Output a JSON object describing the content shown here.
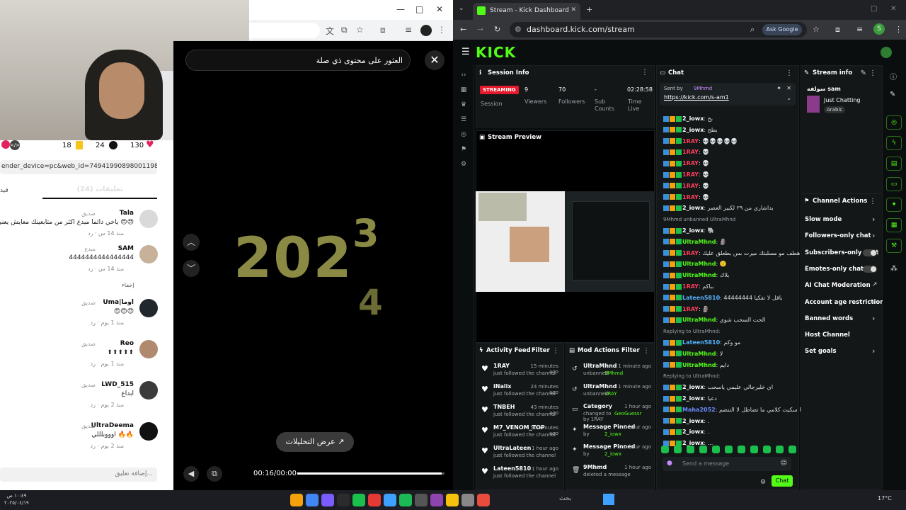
{
  "left_browser": {
    "search_text": "العثور على محتوى ذي صلة",
    "window_controls": {
      "minimize": "—",
      "maximize": "□",
      "close": "✕"
    }
  },
  "tiktok": {
    "stats": {
      "likes": "130",
      "comments": "24",
      "saves": "18"
    },
    "url_fragment": "ender_device=pc&web_id=7494199089800119863",
    "comments_tab": "تعليقات (24)",
    "other_tab": "قيد",
    "hide_label": "إخفاء",
    "input_placeholder": "إضافة تعليق...",
    "comments": [
      {
        "name": "Tala",
        "tag": "صديق",
        "text": "ياخي دائما مبدع اكثر من متابعينك معايش يعني 😍😍",
        "meta": "منذ 14 س · رد"
      },
      {
        "name": "SAM",
        "tag": "مبدع",
        "text": "4444444444444444",
        "meta": "منذ 14 س · رد"
      },
      {
        "name": "Uma|اوما",
        "tag": "صديق",
        "text": "😍😍😍",
        "meta": "منذ 1 يوم · رد"
      },
      {
        "name": "Reo",
        "tag": "صديق",
        "text": "⬆⬆⬆⬆⬆",
        "meta": "منذ 1 يوم · رد"
      },
      {
        "name": "LWD_515",
        "tag": "صديق",
        "text": "ابداع",
        "meta": "منذ 2 يوم · رد"
      },
      {
        "name": "UltraDeema",
        "tag": "صديق",
        "text": "اوووبلللي 🔥🔥",
        "meta": "منذ 2 يوم · رد"
      }
    ]
  },
  "video": {
    "year_text": "202",
    "digit_top": "3",
    "digit_bottom": "4",
    "analytics_button": "عرض التحليلات",
    "time": "00:16/00:00",
    "progress_fraction": 0.98
  },
  "right_browser": {
    "tab_title": "Stream - Kick Dashboard",
    "url": "dashboard.kick.com/stream",
    "ask_google": "Ask Google"
  },
  "kick": {
    "logo": "KICK",
    "session_info": {
      "title": "Session Info",
      "status": "STREAMING",
      "status_label": "Session",
      "viewers": "9",
      "viewers_label": "Viewers",
      "followers": "70",
      "followers_label": "Followers",
      "subs": "-",
      "subs_label": "Sub Counts",
      "time": "02:28:58",
      "time_label": "Time Live"
    },
    "stream_preview": {
      "title": "Stream Preview"
    },
    "activity_feed": {
      "title": "Activity Feed",
      "filter": "Filter",
      "items": [
        {
          "name": "1RAY",
          "sub": "just followed the channel",
          "time": "15 minutes ago"
        },
        {
          "name": "iNalix",
          "sub": "just followed the channel",
          "time": "24 minutes ago"
        },
        {
          "name": "TNBEH",
          "sub": "just followed the channel",
          "time": "43 minutes ago"
        },
        {
          "name": "M7_VENOM_TOP",
          "sub": "just followed the channel",
          "time": "55 minutes ago"
        },
        {
          "name": "UltraLateen",
          "sub": "just followed the channel",
          "time": "1 hour ago"
        },
        {
          "name": "Lateen5810",
          "sub": "just followed the channel",
          "time": "1 hour ago"
        }
      ]
    },
    "mod_actions": {
      "title": "Mod Actions",
      "filter": "Filter",
      "items": [
        {
          "name": "UltraMhnd",
          "line1": "unbanned",
          "target": "9Mhmd",
          "time": "1 minute ago"
        },
        {
          "name": "UltraMhnd",
          "line1": "unbanned",
          "target": "1RAY",
          "time": "1 minute ago"
        },
        {
          "name": "Category",
          "line1": "changed to",
          "target": "GeoGuessr",
          "line2": "by 1RAY",
          "time": "1 hour ago"
        },
        {
          "name": "Message Pinned",
          "line1": "by",
          "target": "2_iowx",
          "time": "1 hour ago"
        },
        {
          "name": "Message Pinned",
          "line1": "by",
          "target": "2_iowx",
          "time": "1 hour ago"
        },
        {
          "name": "9Mhmd",
          "line1": "deleted a message",
          "target": "",
          "time": "1 hour ago"
        }
      ]
    },
    "chat": {
      "title": "Chat",
      "pinned_by": "Sent by",
      "pinned_user": "9Mhmd",
      "pinned_link": "https://kick.com/s-am1",
      "messages": [
        {
          "user": "2_iowx",
          "text": "بح",
          "color": "#ffffff"
        },
        {
          "user": "2_iowx",
          "text": "بطح",
          "color": "#ffffff"
        },
        {
          "user": "1RAY",
          "text": "💀💀💀💀💀",
          "color": "#ff3b5c"
        },
        {
          "user": "1RAY",
          "text": "💀",
          "color": "#ff3b5c"
        },
        {
          "user": "1RAY",
          "text": "💀",
          "color": "#ff3b5c"
        },
        {
          "user": "1RAY",
          "text": "💀",
          "color": "#ff3b5c"
        },
        {
          "user": "1RAY",
          "text": "💀",
          "color": "#ff3b5c"
        },
        {
          "user": "1RAY",
          "text": "💀",
          "color": "#ff3b5c"
        },
        {
          "user": "2_iowx",
          "text": "بداشاري من ٢٩ لكبير العصر",
          "color": "#ffffff"
        },
        {
          "user": "system",
          "text": "9Mhmd unbanned UltraMhnd",
          "color": "#9aa0a6"
        },
        {
          "user": "2_iowx",
          "text": "🐘",
          "color": "#ffffff"
        },
        {
          "user": "UltraMhnd",
          "text": "🗿",
          "color": "#53fc18"
        },
        {
          "user": "1RAY",
          "text": "مهند ياهطف مو مسلبتك ميرت بس بطعلق عليك",
          "color": "#ff3b5c"
        },
        {
          "user": "UltraMhnd",
          "text": "🙂",
          "color": "#53fc18"
        },
        {
          "user": "UltraMhnd",
          "text": "بلاك",
          "color": "#53fc18"
        },
        {
          "user": "1RAY",
          "text": "بباكم",
          "color": "#ff3b5c"
        },
        {
          "user": "Lateen5810",
          "text": "باقل لا تفكيا 44444444",
          "color": "#56b4ff"
        },
        {
          "user": "1RAY",
          "text": "🗿",
          "color": "#ff3b5c"
        },
        {
          "user": "UltraMhnd",
          "text": "الحت السحب شوي",
          "color": "#53fc18"
        },
        {
          "user": "reply",
          "text": "Replying to UltraMhnd:",
          "color": "#9aa0a6"
        },
        {
          "user": "Lateen5810",
          "text": "مو وكم",
          "color": "#56b4ff"
        },
        {
          "user": "UltraMhnd",
          "text": "لا",
          "color": "#53fc18"
        },
        {
          "user": "UltraMhnd",
          "text": "دايم",
          "color": "#53fc18"
        },
        {
          "user": "reply",
          "text": "Replying to UltraMhnd:",
          "color": "#9aa0a6"
        },
        {
          "user": "2_iowx",
          "text": "اي خليرجالي عليمي ياسحب",
          "color": "#ffffff"
        },
        {
          "user": "2_iowx",
          "text": "دعيا",
          "color": "#ffffff"
        },
        {
          "user": "Maha2052",
          "text": "مهند ترا سكيت كلامي ما تضاطل لا التنضم",
          "color": "#6a8cff"
        },
        {
          "user": "2_iowx",
          "text": ".",
          "color": "#ffffff"
        },
        {
          "user": "2_iowx",
          "text": ".",
          "color": "#ffffff"
        },
        {
          "user": "2_iowx",
          "text": "...",
          "color": "#ffffff"
        }
      ],
      "input_placeholder": "Send a message",
      "send_button": "Chat"
    },
    "stream_info": {
      "title": "Stream info",
      "stream_title": "سولفه sam",
      "category": "Just Chatting",
      "tag": "Arabic"
    },
    "channel_actions": {
      "title": "Channel Actions",
      "rows": [
        {
          "label": "Slow mode",
          "control": "chevron"
        },
        {
          "label": "Followers-only chat",
          "control": "chevron"
        },
        {
          "label": "Subscribers-only chat",
          "control": "toggle"
        },
        {
          "label": "Emotes-only chat",
          "control": "toggle"
        },
        {
          "label": "AI Chat Moderation",
          "control": "external"
        },
        {
          "label": "Account age restriction",
          "control": "chevron"
        },
        {
          "label": "Banned words",
          "control": "chevron"
        },
        {
          "label": "Host Channel",
          "control": "none"
        },
        {
          "label": "Set goals",
          "control": "chevron"
        }
      ]
    }
  },
  "taskbar": {
    "time": "١٠:٤٩ ص",
    "date": "٢٠٢٥/٠٤/١٩",
    "weather": "17°C",
    "search": "بحث"
  }
}
